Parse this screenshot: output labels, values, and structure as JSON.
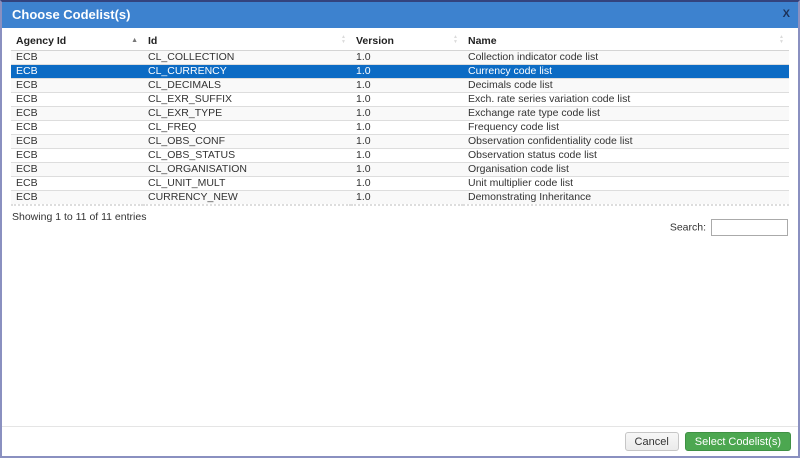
{
  "dialog": {
    "title": "Choose Codelist(s)",
    "close_label": "X"
  },
  "icons": {
    "sort_asc": "▲",
    "sort_desc": "▼"
  },
  "table": {
    "columns": [
      {
        "label": "Agency Id",
        "sorted": "ascending"
      },
      {
        "label": "Id",
        "sorted": "none"
      },
      {
        "label": "Version",
        "sorted": "none"
      },
      {
        "label": "Name",
        "sorted": "none"
      }
    ],
    "rows": [
      {
        "agency_id": "ECB",
        "id": "CL_COLLECTION",
        "version": "1.0",
        "name": "Collection indicator code list",
        "selected": false
      },
      {
        "agency_id": "ECB",
        "id": "CL_CURRENCY",
        "version": "1.0",
        "name": "Currency code list",
        "selected": true
      },
      {
        "agency_id": "ECB",
        "id": "CL_DECIMALS",
        "version": "1.0",
        "name": "Decimals code list",
        "selected": false
      },
      {
        "agency_id": "ECB",
        "id": "CL_EXR_SUFFIX",
        "version": "1.0",
        "name": "Exch. rate series variation code list",
        "selected": false
      },
      {
        "agency_id": "ECB",
        "id": "CL_EXR_TYPE",
        "version": "1.0",
        "name": "Exchange rate type code list",
        "selected": false
      },
      {
        "agency_id": "ECB",
        "id": "CL_FREQ",
        "version": "1.0",
        "name": "Frequency code list",
        "selected": false
      },
      {
        "agency_id": "ECB",
        "id": "CL_OBS_CONF",
        "version": "1.0",
        "name": "Observation confidentiality code list",
        "selected": false
      },
      {
        "agency_id": "ECB",
        "id": "CL_OBS_STATUS",
        "version": "1.0",
        "name": "Observation status code list",
        "selected": false
      },
      {
        "agency_id": "ECB",
        "id": "CL_ORGANISATION",
        "version": "1.0",
        "name": "Organisation code list",
        "selected": false
      },
      {
        "agency_id": "ECB",
        "id": "CL_UNIT_MULT",
        "version": "1.0",
        "name": "Unit multiplier code list",
        "selected": false
      },
      {
        "agency_id": "ECB",
        "id": "CURRENCY_NEW",
        "version": "1.0",
        "name": "Demonstrating Inheritance",
        "selected": false
      }
    ],
    "info_text": "Showing 1 to 11 of 11 entries"
  },
  "search": {
    "label": "Search:",
    "value": "",
    "placeholder": ""
  },
  "footer": {
    "cancel_label": "Cancel",
    "select_label": "Select Codelist(s)"
  },
  "colors": {
    "header_bg": "#3d82cf",
    "selected_row": "#0c6bc4",
    "select_button": "#4ca750",
    "dialog_border": "#8a90c0"
  }
}
